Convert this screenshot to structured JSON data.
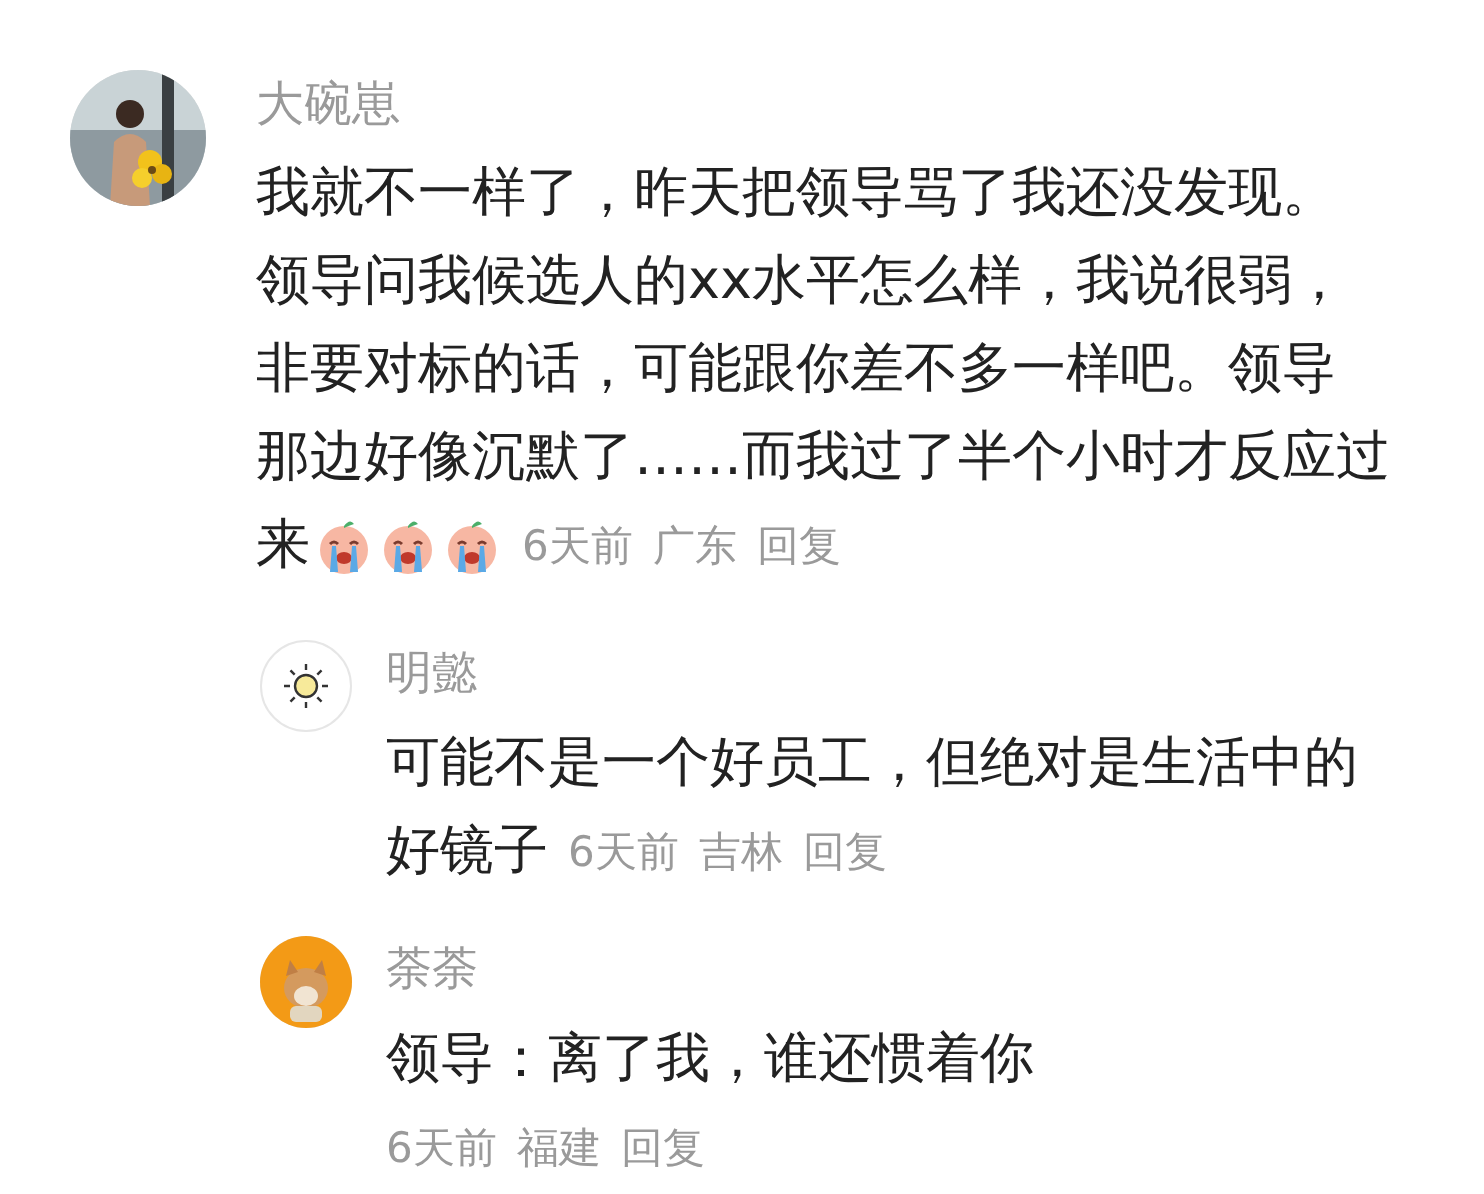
{
  "comment": {
    "author": "大碗崽",
    "avatar": {
      "kind": "picture"
    },
    "lines": [
      "我就不一样了，昨天把领导骂了我还没发现。",
      "领导问我候选人的xx水平怎么样，我说很弱，",
      "非要对标的话，可能跟你差不多一样吧。领导",
      "那边好像沉默了……而我过了半个小时才反应过",
      "来"
    ],
    "emojis": [
      {
        "kind": "crying"
      },
      {
        "kind": "crying"
      },
      {
        "kind": "crying"
      }
    ],
    "time": "6天前",
    "location": "广东",
    "reply": "回复",
    "replies": [
      {
        "author": "明懿",
        "avatar": {
          "kind": "sun"
        },
        "lines": [
          "可能不是一个好员工，但绝对是生活中的",
          "好镜子"
        ],
        "time": "6天前",
        "location": "吉林",
        "reply": "回复"
      },
      {
        "author": "荼荼",
        "avatar": {
          "kind": "picture"
        },
        "lines": [
          "领导：离了我，谁还惯着你"
        ],
        "time": "6天前",
        "location": "福建",
        "reply": "回复"
      }
    ]
  }
}
